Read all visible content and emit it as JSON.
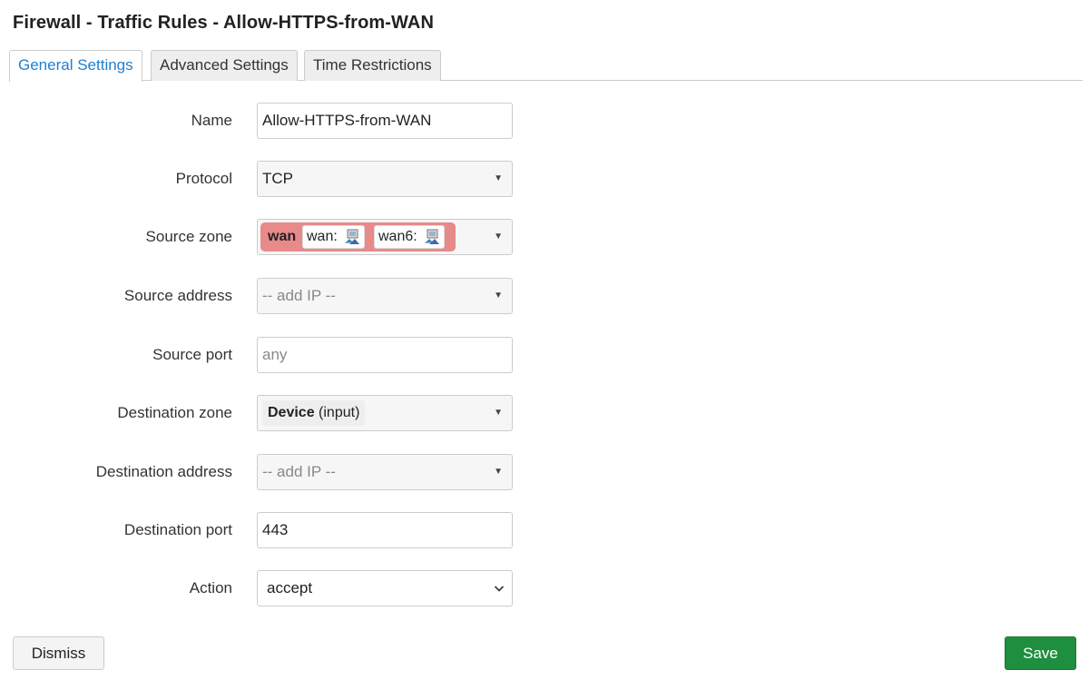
{
  "title": "Firewall - Traffic Rules - Allow-HTTPS-from-WAN",
  "tabs": [
    {
      "label": "General Settings",
      "active": true
    },
    {
      "label": "Advanced Settings",
      "active": false
    },
    {
      "label": "Time Restrictions",
      "active": false
    }
  ],
  "form": {
    "name": {
      "label": "Name",
      "value": "Allow-HTTPS-from-WAN"
    },
    "protocol": {
      "label": "Protocol",
      "value": "TCP"
    },
    "source_zone": {
      "label": "Source zone",
      "zone": "wan",
      "interfaces": [
        "wan:",
        "wan6:"
      ],
      "zone_color": "#e8898a"
    },
    "source_address": {
      "label": "Source address",
      "placeholder": "-- add IP --"
    },
    "source_port": {
      "label": "Source port",
      "placeholder": "any"
    },
    "destination_zone": {
      "label": "Destination zone",
      "zone": "Device",
      "qualifier": "(input)"
    },
    "destination_address": {
      "label": "Destination address",
      "placeholder": "-- add IP --"
    },
    "destination_port": {
      "label": "Destination port",
      "value": "443"
    },
    "action": {
      "label": "Action",
      "value": "accept"
    }
  },
  "buttons": {
    "dismiss": "Dismiss",
    "save": "Save"
  },
  "colors": {
    "active_tab": "#1f7fd0",
    "save": "#1e8f3e"
  }
}
